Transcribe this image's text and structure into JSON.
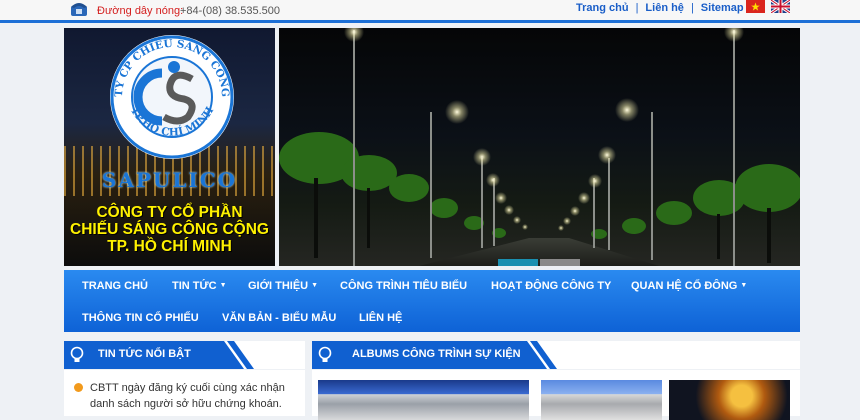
{
  "topbar": {
    "hotline_label": "Đường dây nóng:",
    "hotline_number": "+84-(08) 38.535.500",
    "links": [
      "Trang chủ",
      "Liên hệ",
      "Sitemap"
    ]
  },
  "logo": {
    "ring_text": "CÔNG TY CP CHIẾU SÁNG CÔNG CỘNG",
    "ring_bottom": "TP.HỒ CHÍ MINH",
    "brand": "SAPULICO",
    "company_lines": [
      "CÔNG TY CỔ PHẦN",
      "CHIẾU SÁNG CÔNG CỘNG",
      "TP. HỒ CHÍ MINH"
    ]
  },
  "slider": {
    "slide_count": 2,
    "active_index": 0
  },
  "nav": {
    "items": [
      {
        "label": "TRANG CHỦ",
        "dropdown": false
      },
      {
        "label": "TIN TỨC",
        "dropdown": true
      },
      {
        "label": "GIỚI THIỆU",
        "dropdown": true
      },
      {
        "label": "CÔNG TRÌNH TIÊU BIỂU",
        "dropdown": false
      },
      {
        "label": "HOẠT ĐỘNG CÔNG TY",
        "dropdown": false
      },
      {
        "label": "QUAN HỆ CỔ ĐÔNG",
        "dropdown": true
      },
      {
        "label": "THÔNG TIN CỔ PHIẾU",
        "dropdown": false
      },
      {
        "label": "VĂN BẢN - BIỂU MẪU",
        "dropdown": false
      },
      {
        "label": "LIÊN HỆ",
        "dropdown": false
      }
    ]
  },
  "news": {
    "title": "TIN TỨC NỔI BẬT",
    "items": [
      "CBTT ngày đăng ký cuối cùng xác nhận danh sách người sở hữu chứng khoán."
    ]
  },
  "albums": {
    "title": "ALBUMS CÔNG TRÌNH SỰ KIỆN"
  },
  "colors": {
    "primary": "#1060d0",
    "nav_top": "#2a8af0",
    "hotline": "#d42020",
    "company_text": "#fff100",
    "bullet": "#f29a1c"
  }
}
